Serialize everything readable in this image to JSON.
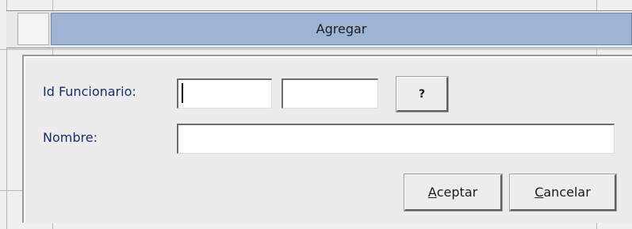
{
  "dialog": {
    "title": "Agregar"
  },
  "form": {
    "id_label": "Id Funcionario:",
    "id_value_1": "",
    "id_value_2": "",
    "help_button_label": "?",
    "name_label": "Nombre:",
    "name_value": ""
  },
  "actions": {
    "accept_mnemonic": "A",
    "accept_rest": "ceptar",
    "cancel_mnemonic": "C",
    "cancel_rest": "ancelar"
  },
  "colors": {
    "title_bar": "#9db5d3",
    "label_text": "#1f2a6b",
    "panel_bg": "#ececec"
  }
}
